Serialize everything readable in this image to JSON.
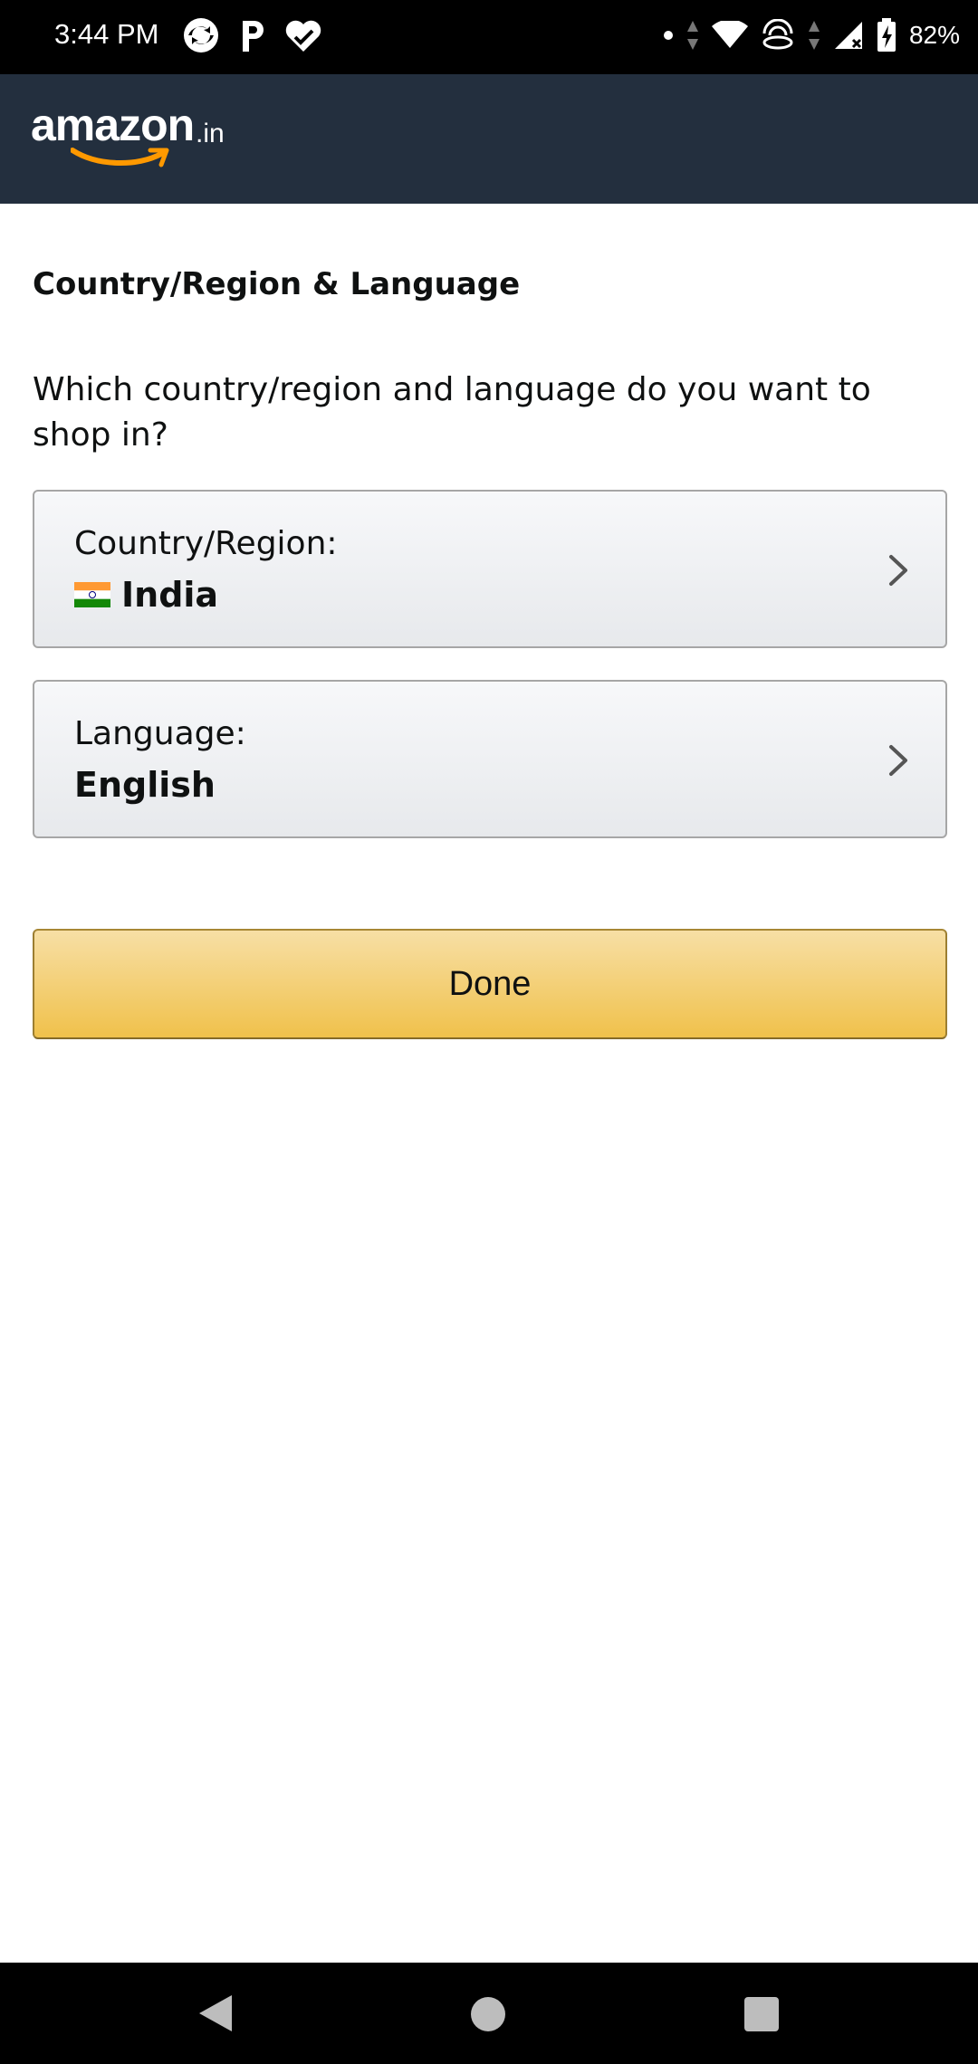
{
  "status_bar": {
    "time": "3:44 PM",
    "battery": "82%",
    "icons": [
      "sync-icon",
      "p-app-icon",
      "heart-check-icon",
      "dot-icon",
      "data-arrows-icon",
      "wifi-icon",
      "hotspot-icon",
      "signal-icon",
      "battery-charging-icon"
    ]
  },
  "header": {
    "logo_text": "amazon",
    "logo_suffix": ".in",
    "colors": {
      "background": "#232f3e",
      "smile": "#ff9900"
    }
  },
  "page": {
    "title": "Country/Region & Language",
    "question": "Which country/region and language do you want to shop in?"
  },
  "country": {
    "label": "Country/Region:",
    "value": "India",
    "flag": "india-flag-icon"
  },
  "language": {
    "label": "Language:",
    "value": "English"
  },
  "done_button": {
    "label": "Done",
    "colors": {
      "top": "#f7dfa5",
      "bottom": "#f0c14b"
    }
  },
  "nav_bar": {
    "icons": [
      "back-icon",
      "home-icon",
      "recents-icon"
    ]
  }
}
